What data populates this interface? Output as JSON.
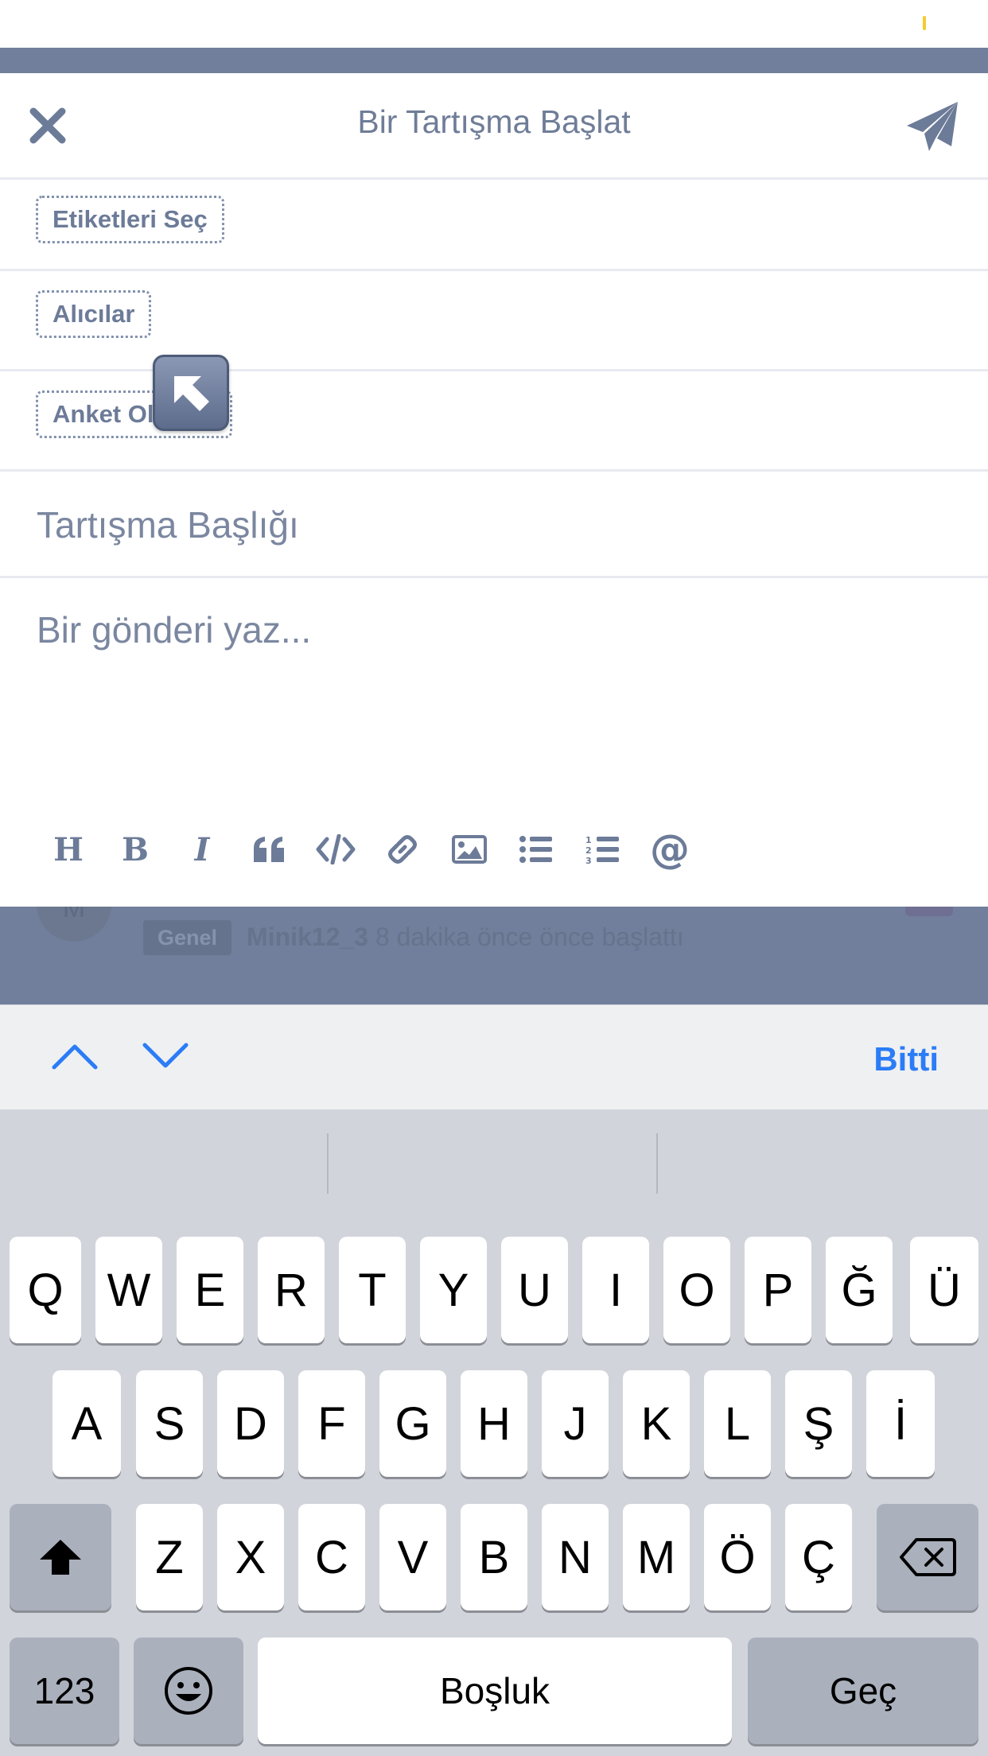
{
  "composer": {
    "title": "Bir Tartışma Başlat",
    "tags_chip": "Etiketleri Seç",
    "recipients_chip": "Alıcılar",
    "poll_chip": "Anket Oluştur",
    "title_placeholder": "Tartışma Başlığı",
    "body_placeholder": "Bir gönderi yaz...",
    "toolbar": [
      "heading-icon",
      "bold-icon",
      "italic-icon",
      "quote-icon",
      "code-icon",
      "link-icon",
      "image-icon",
      "bullet-list-icon",
      "numbered-list-icon",
      "mention-icon"
    ]
  },
  "background_discussion": {
    "avatar_letter": "M",
    "tag": "Genel",
    "author": "Minik12_3",
    "meta": "8 dakika önce önce başlattı"
  },
  "accessory": {
    "done_label": "Bitti"
  },
  "keyboard": {
    "row1": [
      "Q",
      "W",
      "E",
      "R",
      "T",
      "Y",
      "U",
      "I",
      "O",
      "P",
      "Ğ",
      "Ü"
    ],
    "row2": [
      "A",
      "S",
      "D",
      "F",
      "G",
      "H",
      "J",
      "K",
      "L",
      "Ş",
      "İ"
    ],
    "row3": [
      "Z",
      "X",
      "C",
      "V",
      "B",
      "N",
      "M",
      "Ö",
      "Ç"
    ],
    "numbers_label": "123",
    "space_label": "Boşluk",
    "return_label": "Geç"
  },
  "colors": {
    "accent": "#2b7cf6",
    "muted_text": "#6f7d98",
    "dim_overlay": "#717f9c",
    "keyboard_bg": "#d1d4db"
  }
}
